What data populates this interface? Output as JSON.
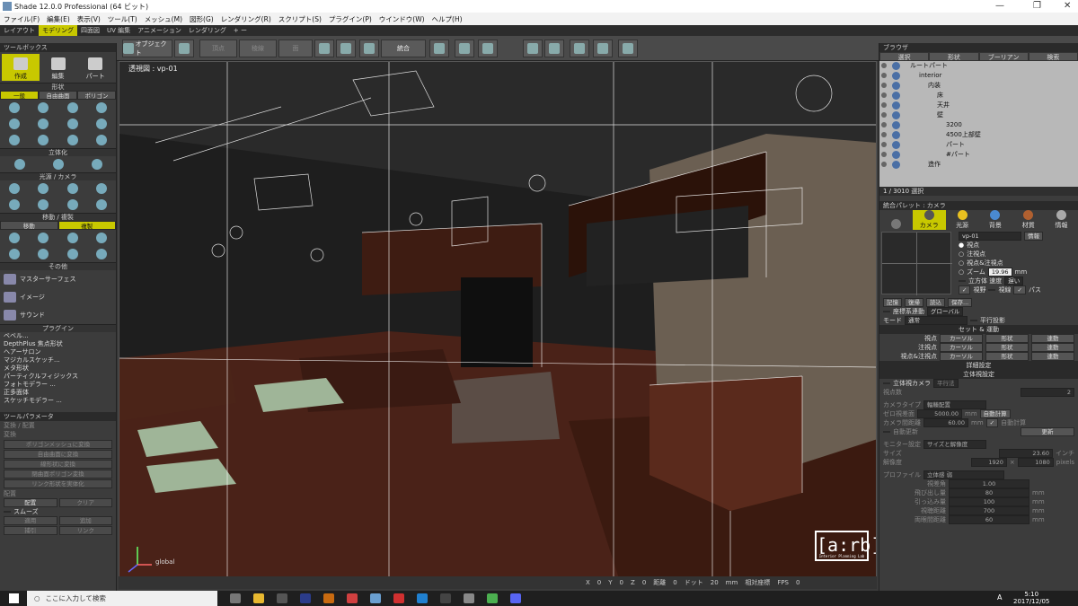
{
  "title": "Shade 12.0.0 Professional (64 ビット)",
  "window_controls": [
    "—",
    "❐",
    "✕"
  ],
  "menu": [
    "ファイル(F)",
    "編集(E)",
    "表示(V)",
    "ツール(T)",
    "メッシュ(M)",
    "図形(G)",
    "レンダリング(R)",
    "スクリプト(S)",
    "プラグイン(P)",
    "ウインドウ(W)",
    "ヘルプ(H)"
  ],
  "mode_tabs": [
    "レイアウト",
    "モデリング",
    "四面図",
    "UV 編集",
    "アニメーション",
    "レンダリング",
    "+ ー"
  ],
  "toolbar": {
    "object": "オブジェクト",
    "vertex": "頂点",
    "edge": "稜線",
    "face": "面",
    "combine": "統合"
  },
  "toolbox": {
    "title": "ツールボックス",
    "create": "作成",
    "edit": "編集",
    "part": "パート",
    "shape": "形状",
    "tabs": [
      "一般",
      "自由曲面",
      "ポリゴン"
    ],
    "solid": "立体化",
    "light_camera": "光源 / カメラ",
    "move_copy": "移動 / 複製",
    "move": "移動",
    "copy": "複製",
    "other": "その他",
    "master_surface": "マスターサーフェス",
    "image": "イメージ",
    "sound": "サウンド",
    "plugin": "プラグイン",
    "plugins": [
      "ベベル...",
      "DepthPlus 焦点形状",
      "ヘアーサロン",
      "マジカルスケッチ...",
      "メタ形状",
      "パーティクルフィジックス",
      "フォトモデラー ...",
      "正多面体",
      "スケッチモデラー ..."
    ]
  },
  "params": {
    "title": "ツールパラメータ",
    "sub": "変換 / 配置",
    "convert": "変換",
    "btns": [
      "ポリゴンメッシュに変換",
      "自由曲面に変換",
      "線形状に変換",
      "閉曲面ポリゴン変換",
      "リンク形状を実体化"
    ],
    "place": "配置",
    "place_btn": "配置",
    "clear": "クリア",
    "smooth": "スムーズ",
    "apply": "適用",
    "add": "追加",
    "capture": "捕引",
    "link": "リンク"
  },
  "viewport": {
    "label": "透視図 : vp-01",
    "axis": "global",
    "status": [
      "X",
      "0",
      "Y",
      "0",
      "Z",
      "0",
      "距離",
      "0",
      "ドット",
      "20",
      "mm",
      "相対座標",
      "FPS",
      "0"
    ]
  },
  "logo": {
    "text": "[a:rb]",
    "sub": "Interior Planning Lab"
  },
  "browser": {
    "title": "ブラウザ",
    "tabs": [
      "選択",
      "形状",
      "ブーリアン",
      "検索"
    ],
    "tree": [
      {
        "label": "ルートパート",
        "indent": 0
      },
      {
        "label": "interior",
        "indent": 1
      },
      {
        "label": "内装",
        "indent": 2
      },
      {
        "label": "床",
        "indent": 3
      },
      {
        "label": "天井",
        "indent": 3
      },
      {
        "label": "壁",
        "indent": 3
      },
      {
        "label": "3200",
        "indent": 4
      },
      {
        "label": "4500上部壁",
        "indent": 4
      },
      {
        "label": "パート",
        "indent": 4
      },
      {
        "label": "#パート",
        "indent": 4
      },
      {
        "label": "造作",
        "indent": 2
      }
    ],
    "count": "1 / 3010 選択"
  },
  "palette": {
    "title": "統合パレット : カメラ",
    "tabs": [
      "カメラ",
      "光源",
      "背景",
      "材質",
      "情報"
    ],
    "camera_name": "vp-01",
    "info": "情報",
    "opts": [
      "視点",
      "注視点",
      "視点&注視点",
      "ズーム"
    ],
    "zoom": "19.96",
    "mm": "mm",
    "stereo": "立方体 速度",
    "speed": "遅い",
    "view": "視野",
    "edge": "視線",
    "path": "パス",
    "memory": "記憶",
    "restore": "復帰",
    "read": "読込",
    "save": "保存...",
    "sync": "座標系連動",
    "global": "グローバル",
    "mode": "モード",
    "normal": "通常",
    "parallel": "平行投影",
    "set_link": "セット & 運動",
    "rows": [
      [
        "視点",
        "カーソル",
        "形状",
        "連動"
      ],
      [
        "注視点",
        "カーソル",
        "形状",
        "連動"
      ],
      [
        "視点&注視点",
        "カーソル",
        "形状",
        "連動"
      ]
    ],
    "detail": "詳細設定",
    "stereo_set": "立体視設定",
    "stereo_cam": "立体視カメラ",
    "parallel_method": "平行法",
    "viewpoints": "視点数",
    "vp_num": "2",
    "cam_type": "カメラタイプ",
    "toe": "輻輳配置",
    "zero": "ゼロ視差面",
    "zero_v": "5000.00",
    "auto_calc": "自動計算",
    "cam_dist": "カメラ間距離",
    "cam_dist_v": "60.00",
    "auto_update": "自動更新",
    "update": "更新",
    "monitor": "モニター設定",
    "size_res": "サイズと解像度",
    "size": "サイズ",
    "size_v": "23.60",
    "inch": "インチ",
    "res": "解像度",
    "res_w": "1920",
    "res_h": "1080",
    "pixels": "pixels",
    "profile": "プロファイル",
    "profile_v": "立体感 弱",
    "p_rows": [
      [
        "視差角",
        "1.00",
        ""
      ],
      [
        "飛び出し量",
        "80",
        "mm"
      ],
      [
        "引っ込み量",
        "100",
        "mm"
      ],
      [
        "視聴距離",
        "700",
        "mm"
      ],
      [
        "両眼間距離",
        "60",
        "mm"
      ]
    ]
  },
  "taskbar": {
    "search": "ここに入力して検索",
    "time": "5:10",
    "date": "2017/12/05",
    "ime": "A"
  }
}
